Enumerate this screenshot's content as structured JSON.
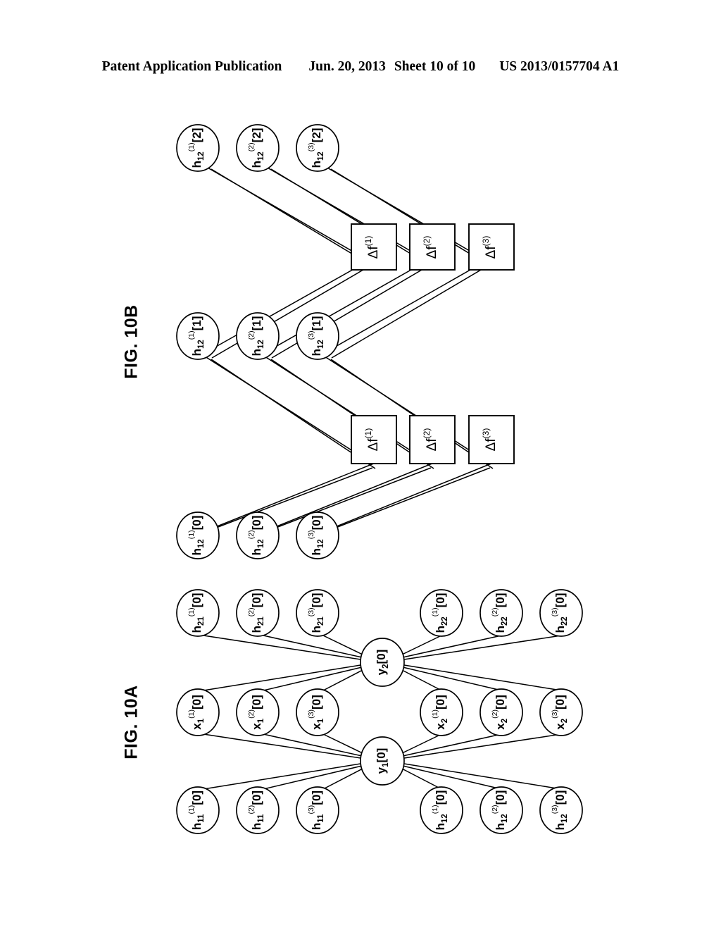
{
  "header": {
    "publication": "Patent Application Publication",
    "date": "Jun. 20, 2013",
    "sheet": "Sheet 10 of 10",
    "doc_number": "US 2013/0157704 A1"
  },
  "figures": [
    {
      "id": "fig-10b",
      "caption": "FIG. 10B",
      "rows": [
        {
          "id": "h12-k2",
          "kind": "circle",
          "nodes": [
            {
              "base": "h",
              "sub": "12",
              "sup": "(1)",
              "index": "[2]",
              "text": "h(1)12[2]"
            },
            {
              "base": "h",
              "sub": "12",
              "sup": "(2)",
              "index": "[2]",
              "text": "h(2)12[2]"
            },
            {
              "base": "h",
              "sub": "12",
              "sup": "(3)",
              "index": "[2]",
              "text": "h(3)12[2]"
            }
          ]
        },
        {
          "id": "df-upper",
          "kind": "box",
          "nodes": [
            {
              "base": "Δf",
              "sup": "(1)",
              "text": "Δf(1)"
            },
            {
              "base": "Δf",
              "sup": "(2)",
              "text": "Δf(2)"
            },
            {
              "base": "Δf",
              "sup": "(3)",
              "text": "Δf(3)"
            }
          ]
        },
        {
          "id": "h12-k1",
          "kind": "circle",
          "nodes": [
            {
              "base": "h",
              "sub": "12",
              "sup": "(1)",
              "index": "[1]",
              "text": "h(1)12[1]"
            },
            {
              "base": "h",
              "sub": "12",
              "sup": "(2)",
              "index": "[1]",
              "text": "h(2)12[1]"
            },
            {
              "base": "h",
              "sub": "12",
              "sup": "(3)",
              "index": "[1]",
              "text": "h(3)12[1]"
            }
          ]
        },
        {
          "id": "df-lower",
          "kind": "box",
          "nodes": [
            {
              "base": "Δf",
              "sup": "(1)",
              "text": "Δf(1)"
            },
            {
              "base": "Δf",
              "sup": "(2)",
              "text": "Δf(2)"
            },
            {
              "base": "Δf",
              "sup": "(3)",
              "text": "Δf(3)"
            }
          ]
        },
        {
          "id": "h12-k0",
          "kind": "circle",
          "nodes": [
            {
              "base": "h",
              "sub": "12",
              "sup": "(1)",
              "index": "[0]",
              "text": "h(1)12[0]"
            },
            {
              "base": "h",
              "sub": "12",
              "sup": "(2)",
              "index": "[0]",
              "text": "h(2)12[0]"
            },
            {
              "base": "h",
              "sub": "12",
              "sup": "(3)",
              "index": "[0]",
              "text": "h(3)12[0]"
            }
          ]
        }
      ]
    },
    {
      "id": "fig-10a",
      "caption": "FIG. 10A",
      "outputs": [
        {
          "base": "y",
          "sub": "2",
          "index": "[0]",
          "text": "y2[0]"
        },
        {
          "base": "y",
          "sub": "1",
          "index": "[0]",
          "text": "y1[0]"
        }
      ],
      "groups": [
        {
          "id": "h21",
          "nodes": [
            {
              "base": "h",
              "sub": "21",
              "sup": "(1)",
              "index": "[0]",
              "text": "h(1)21[0]"
            },
            {
              "base": "h",
              "sub": "21",
              "sup": "(2)",
              "index": "[0]",
              "text": "h(2)21[0]"
            },
            {
              "base": "h",
              "sub": "21",
              "sup": "(3)",
              "index": "[0]",
              "text": "h(3)21[0]"
            }
          ]
        },
        {
          "id": "h22",
          "nodes": [
            {
              "base": "h",
              "sub": "22",
              "sup": "(1)",
              "index": "[0]",
              "text": "h(1)22[0]"
            },
            {
              "base": "h",
              "sub": "22",
              "sup": "(2)",
              "index": "[0]",
              "text": "h(2)22[0]"
            },
            {
              "base": "h",
              "sub": "22",
              "sup": "(3)",
              "index": "[0]",
              "text": "h(3)22[0]"
            }
          ]
        },
        {
          "id": "x1",
          "nodes": [
            {
              "base": "x",
              "sub": "1",
              "sup": "(1)",
              "index": "[0]",
              "text": "x(1)1[0]"
            },
            {
              "base": "x",
              "sub": "1",
              "sup": "(2)",
              "index": "[0]",
              "text": "x(2)1[0]"
            },
            {
              "base": "x",
              "sub": "1",
              "sup": "(3)",
              "index": "[0]",
              "text": "x(3)1[0]"
            }
          ]
        },
        {
          "id": "x2",
          "nodes": [
            {
              "base": "x",
              "sub": "2",
              "sup": "(1)",
              "index": "[0]",
              "text": "x(1)2[0]"
            },
            {
              "base": "x",
              "sub": "2",
              "sup": "(2)",
              "index": "[0]",
              "text": "x(2)2[0]"
            },
            {
              "base": "x",
              "sub": "2",
              "sup": "(3)",
              "index": "[0]",
              "text": "x(3)2[0]"
            }
          ]
        },
        {
          "id": "h11",
          "nodes": [
            {
              "base": "h",
              "sub": "11",
              "sup": "(1)",
              "index": "[0]",
              "text": "h(1)11[0]"
            },
            {
              "base": "h",
              "sub": "11",
              "sup": "(2)",
              "index": "[0]",
              "text": "h(2)11[0]"
            },
            {
              "base": "h",
              "sub": "11",
              "sup": "(3)",
              "index": "[0]",
              "text": "h(3)11[0]"
            }
          ]
        },
        {
          "id": "h12",
          "nodes": [
            {
              "base": "h",
              "sub": "12",
              "sup": "(1)",
              "index": "[0]",
              "text": "h(1)12[0]"
            },
            {
              "base": "h",
              "sub": "12",
              "sup": "(2)",
              "index": "[0]",
              "text": "h(2)12[0]"
            },
            {
              "base": "h",
              "sub": "12",
              "sup": "(3)",
              "index": "[0]",
              "text": "h(3)12[0]"
            }
          ]
        }
      ]
    }
  ],
  "colors": {
    "ink": "#000000",
    "paper": "#ffffff"
  }
}
